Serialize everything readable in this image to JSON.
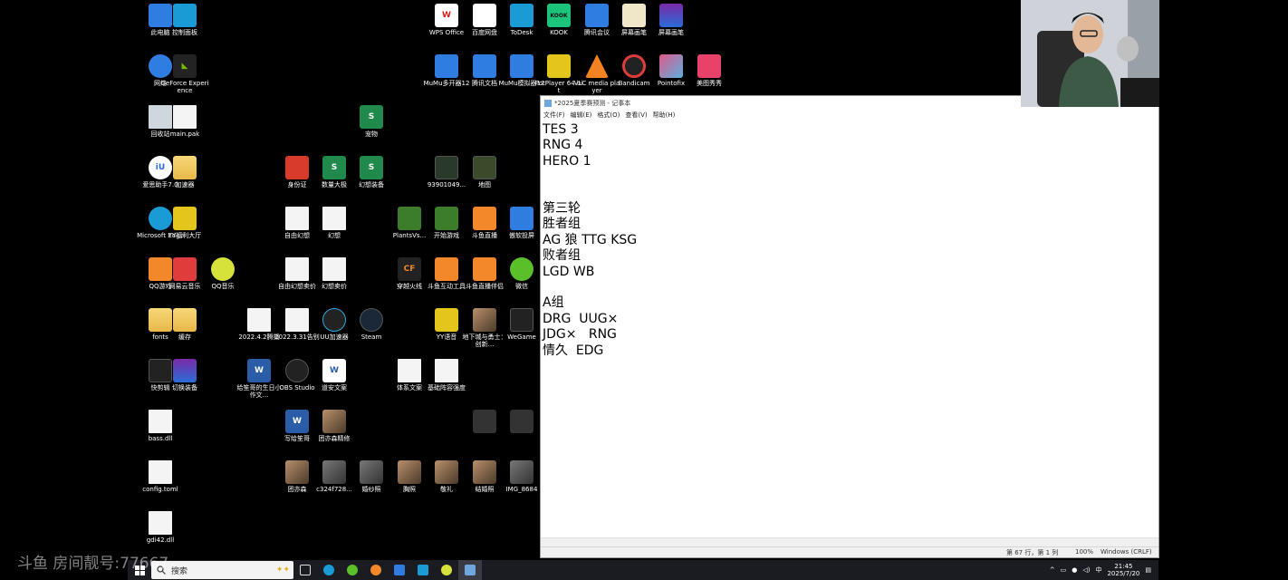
{
  "watermark": "斗鱼 房间靓号:77667",
  "desktop_icons": {
    "this_pc": "此电脑",
    "control_panel": "控制面板",
    "network": "网络",
    "geforce": "GeForce Experience",
    "recycle_bin": "回收站",
    "main_pak": "main.pak",
    "pet": "宠物",
    "aisi": "爱思助手7.0",
    "accel": "加速器",
    "id_card": "身份证",
    "data_big": "数量大极",
    "fantasy_equip": "幻想装备",
    "num_939": "939010​49...",
    "map": "地图",
    "edge": "Microsoft Edge",
    "yy_welfare": "YY福利大厅",
    "free_fantasy": "自由幻想",
    "fantasy": "幻想",
    "plants": "PlantsVs...",
    "start_game": "开始游戏",
    "douyu_live": "斗鱼直播",
    "aoruan": "傲软投屏",
    "qq_game": "QQ游戏",
    "netease_music": "网易云音乐",
    "qq_music": "QQ音乐",
    "free_fantasy_sell": "自由幻想卖价",
    "fantasy_sell": "幻想卖价",
    "crossfire": "穿越火线",
    "douyu_tool": "斗鱼互动工具",
    "douyu_partner": "斗鱼直播伴侣",
    "wechat": "微信",
    "fonts": "fonts",
    "cache": "缓存",
    "d20220402": "2022.4.2腾播",
    "d20220331": "2022.3.31告别",
    "uu": "UU加速器",
    "steam": "Steam",
    "yy_voice": "YY语音",
    "dnf": "地下城与勇士：创新...",
    "wegame": "WeGame",
    "kuaijian": "快剪辑",
    "switch_equip": "切换装备",
    "birthday_doc": "给笙哥的生日小作文...",
    "obs": "OBS Studio",
    "farewell_doc": "道安文案",
    "system_copy": "体系文案",
    "base_lineup": "基础阵容强度",
    "bass_dll": "bass.dll",
    "write_sheng": "写给笙哥",
    "team_yearbook": "团亦森精修",
    "img_a": "",
    "img_b": "",
    "config_toml": "config.toml",
    "tuanyi": "团亦森",
    "c324": "c324f728...",
    "wedding": "婚纱照",
    "chest": "胸照",
    "salute": "敬礼",
    "wedding2": "结婚照",
    "img_8684": "IMG_8684",
    "gdi42": "gdi42.dll",
    "wps": "WPS Office",
    "baidu_pan": "百度网盘",
    "todesk": "ToDesk",
    "kook": "KOOK",
    "tencent_meeting": "腾讯会议",
    "screen_draw1": "屏幕画笔",
    "screen_draw2": "屏幕画笔",
    "mumu12": "MuMu多开器12",
    "tencent_doc": "腾讯文档",
    "mumu_emu": "MuMu模拟器12",
    "potplayer": "PotPlayer 64 bit",
    "vlc": "VLC media player",
    "bandicam": "Bandicam",
    "pointofix": "Pointofix",
    "meitu": "美图秀秀"
  },
  "icon_glyphs": {
    "kook": "KOOK",
    "wps": "W",
    "xls": "S",
    "doc": "W"
  },
  "notepad": {
    "title": "*2025夏季赛预测 - 记事本",
    "menu": [
      "文件(F)",
      "编辑(E)",
      "格式(O)",
      "查看(V)",
      "帮助(H)"
    ],
    "content": "TES 3\nRNG 4\nHERO 1\n\n\n第三轮\n胜者组\nAG 狼 TTG KSG\n败者组\nLGD WB\n\nA组\nDRG  UUG×\nJDG×   RNG\n情久  EDG\n",
    "status": {
      "position": "第 67 行，第 1 列",
      "zoom": "100%",
      "encoding": "Windows (CRLF)"
    }
  },
  "taskbar": {
    "search_placeholder": "搜索",
    "time": "21:45",
    "date": "2025/7/20",
    "ime": "中"
  },
  "colors": {
    "taskbar": "#1b1b22",
    "desktop": "#000000"
  }
}
